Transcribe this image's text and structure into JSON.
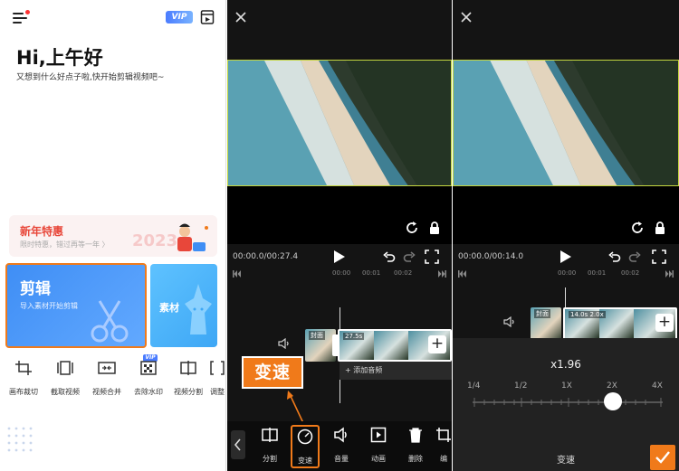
{
  "home": {
    "vip_label": "VIP",
    "greeting": "Hi,上午好",
    "subtitle": "又想到什么好点子啦,快开始剪辑视频吧~",
    "promo": {
      "title": "新年特惠",
      "subtitle": "限时特惠，错过再等一年 〉"
    },
    "edit_card": {
      "title": "剪辑",
      "subtitle": "导入素材开始剪辑"
    },
    "material_label": "素材",
    "tools": [
      {
        "label": "画布裁切",
        "icon": "crop-icon"
      },
      {
        "label": "截取视频",
        "icon": "trim-video-icon"
      },
      {
        "label": "视频合并",
        "icon": "merge-icon"
      },
      {
        "label": "去除水印",
        "icon": "watermark-icon",
        "badge": "VIP"
      },
      {
        "label": "视频分割",
        "icon": "split-video-icon"
      },
      {
        "label": "调整",
        "icon": "adjust-icon"
      }
    ]
  },
  "editor1": {
    "time": "00:00.0/00:27.4",
    "ruler": [
      "00:00",
      "00:01",
      "00:02"
    ],
    "clip_label_front": "封面",
    "clip_duration": "27.5s",
    "add_audio": "+ 添加音频",
    "callout": "变速",
    "toolbar": [
      {
        "label": "分割",
        "icon": "split-icon"
      },
      {
        "label": "变速",
        "icon": "speed-icon"
      },
      {
        "label": "音量",
        "icon": "volume-icon"
      },
      {
        "label": "动画",
        "icon": "animation-icon"
      },
      {
        "label": "删除",
        "icon": "delete-icon"
      },
      {
        "label": "编",
        "icon": "edit-icon"
      }
    ]
  },
  "editor2": {
    "time": "00:00.0/00:14.0",
    "ruler": [
      "00:00",
      "00:01",
      "00:02"
    ],
    "clip_label_front": "封面",
    "clip_badge": "14.0s  2.0x",
    "speed_value": "x1.96",
    "speed_current": 1.96,
    "scale": [
      "1/4",
      "1/2",
      "1X",
      "2X",
      "4X"
    ],
    "panel_label": "变速"
  },
  "colors": {
    "accent": "#f07a1a",
    "brand_blue": "#3f8ef5",
    "promo_red": "#e8473a"
  }
}
